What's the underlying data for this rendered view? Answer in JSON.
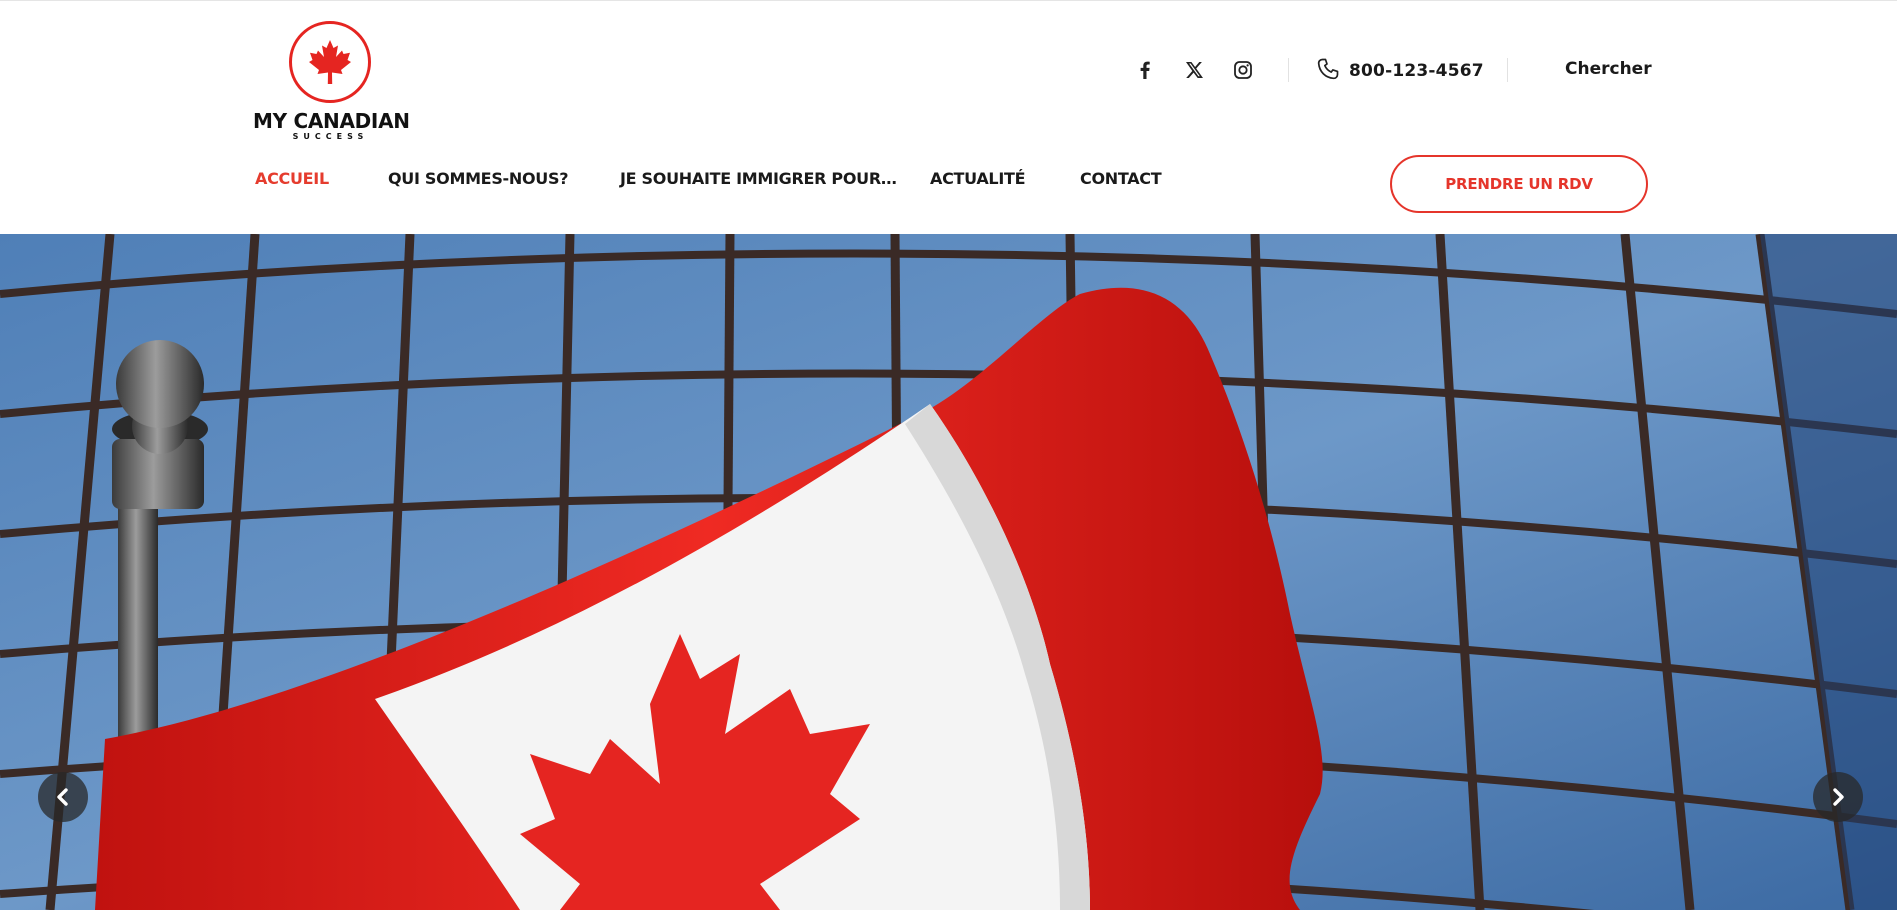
{
  "brand": {
    "name": "MY CANADIAN",
    "tagline": "SUCCESS",
    "accent_color": "#e5352b"
  },
  "topbar": {
    "social": [
      {
        "icon": "facebook-icon"
      },
      {
        "icon": "x-twitter-icon"
      },
      {
        "icon": "instagram-icon"
      }
    ],
    "phone": "800-123-4567",
    "search_label": "Chercher"
  },
  "nav": {
    "items": [
      {
        "label": "ACCUEIL",
        "active": true
      },
      {
        "label": "QUI SOMMES-NOUS?",
        "active": false
      },
      {
        "label": "JE SOUHAITE IMMIGRER POUR…",
        "active": false
      },
      {
        "label": "ACTUALITÉ",
        "active": false
      },
      {
        "label": "CONTACT",
        "active": false
      }
    ],
    "cta_label": "PRENDRE UN RDV"
  },
  "hero": {
    "image": "canadian-flag-on-glass-building",
    "prev_icon": "chevron-left-icon",
    "next_icon": "chevron-right-icon"
  }
}
